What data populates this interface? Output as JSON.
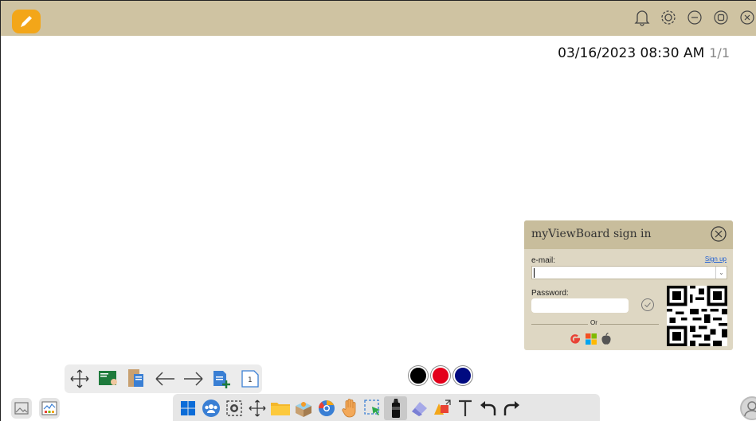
{
  "header": {
    "datetime": "03/16/2023 08:30 AM",
    "page_indicator": "1/1"
  },
  "signin": {
    "title": "myViewBoard sign in",
    "email_label": "e-mail:",
    "signup_label": "Sign up",
    "email_value": "",
    "password_label": "Password:",
    "or_label": "Or"
  },
  "pen_colors": [
    "#000000",
    "#e3001b",
    "#000a80"
  ],
  "colors": {
    "titlebar": "#cfc3a2",
    "accent": "#f3a619"
  }
}
